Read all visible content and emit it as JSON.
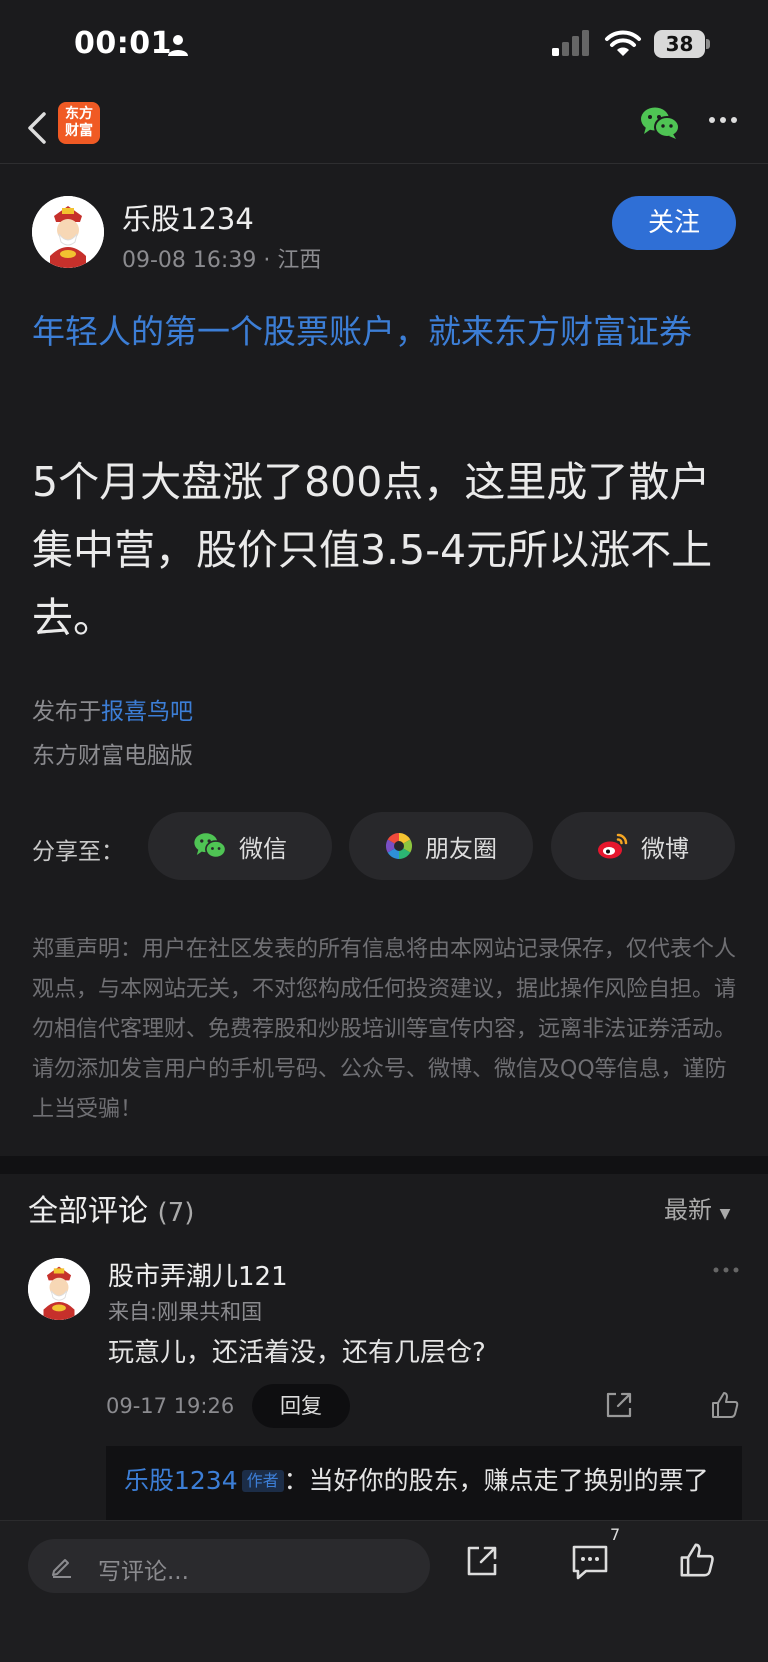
{
  "status_bar": {
    "time": "00:01",
    "battery": "38"
  },
  "nav": {
    "logo_line1": "东方",
    "logo_line2": "财富"
  },
  "post": {
    "author_name": "乐股1234",
    "date": "09-08 16:39",
    "location": "江西",
    "follow_label": "关注",
    "ad_title": "年轻人的第一个股票账户，就来东方财富证券",
    "body": "5个月大盘涨了800点，这里成了散户集中营，股价只值3.5-4元所以涨不上去。",
    "published_prefix": "发布于",
    "published_bar": "报喜鸟吧",
    "source": "东方财富电脑版"
  },
  "share": {
    "label": "分享至：",
    "wechat": "微信",
    "moments": "朋友圈",
    "weibo": "微博"
  },
  "disclaimer": "郑重声明：用户在社区发表的所有信息将由本网站记录保存，仅代表个人观点，与本网站无关，不对您构成任何投资建议，据此操作风险自担。请勿相信代客理财、免费荐股和炒股培训等宣传内容，远离非法证券活动。请勿添加发言用户的手机号码、公众号、微博、微信及QQ等信息，谨防上当受骗！",
  "comments": {
    "title": "全部评论",
    "count": "(7)",
    "sort": "最新",
    "items": [
      {
        "user": "股市弄潮儿121",
        "source": "来自:刚果共和国",
        "text": "玩意儿，还活着没，还有几层仓?",
        "time": "09-17 19:26",
        "reply_label": "回复",
        "reply": {
          "author": "乐股1234",
          "tag": "作者",
          "separator": "：",
          "text": "当好你的股东，赚点走了换别的票了"
        }
      }
    ]
  },
  "bottom_bar": {
    "input_placeholder": "写评论...",
    "comment_count": "7"
  },
  "colors": {
    "background": "#1b1b1d",
    "accent_blue": "#3c7ed6",
    "follow_button": "#2f6fd6",
    "logo_orange": "#f05a24",
    "wechat_green": "#4fc454"
  }
}
